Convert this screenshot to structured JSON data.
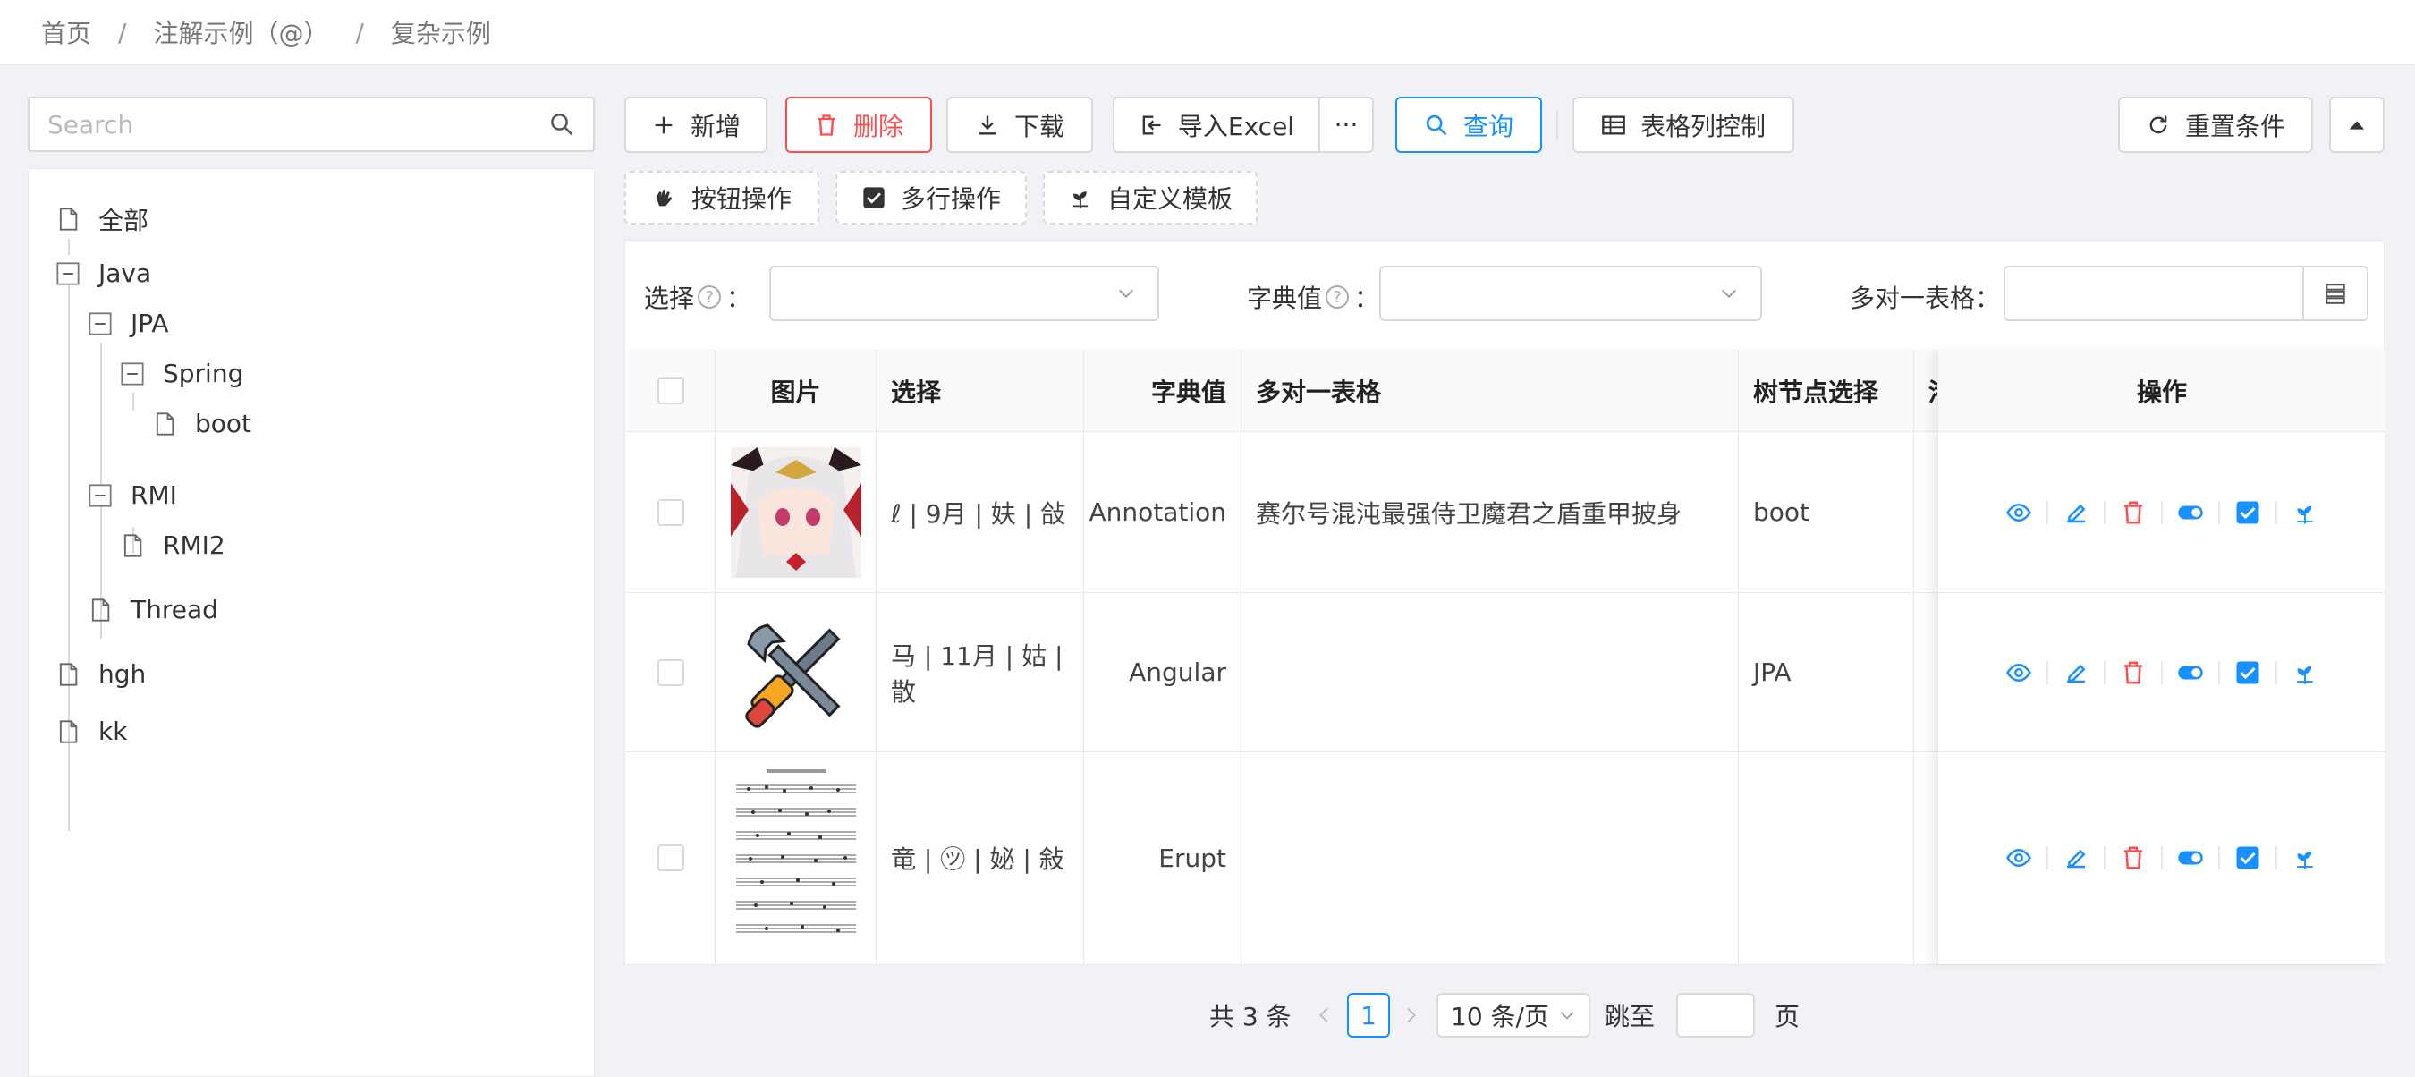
{
  "breadcrumb": {
    "home": "首页",
    "parent": "注解示例（@）",
    "current": "复杂示例",
    "sep": "/"
  },
  "sidebar": {
    "search_placeholder": "Search",
    "tree": {
      "all": "全部",
      "java": "Java",
      "jpa": "JPA",
      "spring": "Spring",
      "boot": "boot",
      "rmi": "RMI",
      "rmi2": "RMI2",
      "thread": "Thread",
      "hgh": "hgh",
      "kk": "kk"
    }
  },
  "toolbar": {
    "add": "新增",
    "delete": "删除",
    "download": "下载",
    "import": "导入Excel",
    "more": "···",
    "query": "查询",
    "columns": "表格列控制",
    "reset": "重置条件",
    "btn_ops": "按钮操作",
    "multi_ops": "多行操作",
    "custom_tpl": "自定义模板"
  },
  "filters": {
    "select_label": "选择",
    "dict_label": "字典值",
    "m2m_label": "多对一表格",
    "colon": "：",
    "q": "?"
  },
  "table": {
    "headers": {
      "image": "图片",
      "select": "选择",
      "dict": "字典值",
      "m2m": "多对一表格",
      "tree": "树节点选择",
      "trunc": "港",
      "ops": "操作"
    },
    "rows": [
      {
        "select": "ℓ | 9月 | 妋 | 敆",
        "dict": "Annotation",
        "m2m": "赛尔号混沌最强侍卫魔君之盾重甲披身",
        "tree": "boot"
      },
      {
        "select": "马 | 11月 | 姑 | 散",
        "dict": "Angular",
        "m2m": "",
        "tree": "JPA"
      },
      {
        "select": "竜 | ㋡ | 妼 | 敍",
        "dict": "Erupt",
        "m2m": "",
        "tree": ""
      }
    ]
  },
  "pagination": {
    "total": "共 3 条",
    "page": "1",
    "size": "10 条/页",
    "jump": "跳至",
    "page_unit": "页"
  },
  "colors": {
    "primary": "#1890ff",
    "danger": "#ff4d4f"
  }
}
